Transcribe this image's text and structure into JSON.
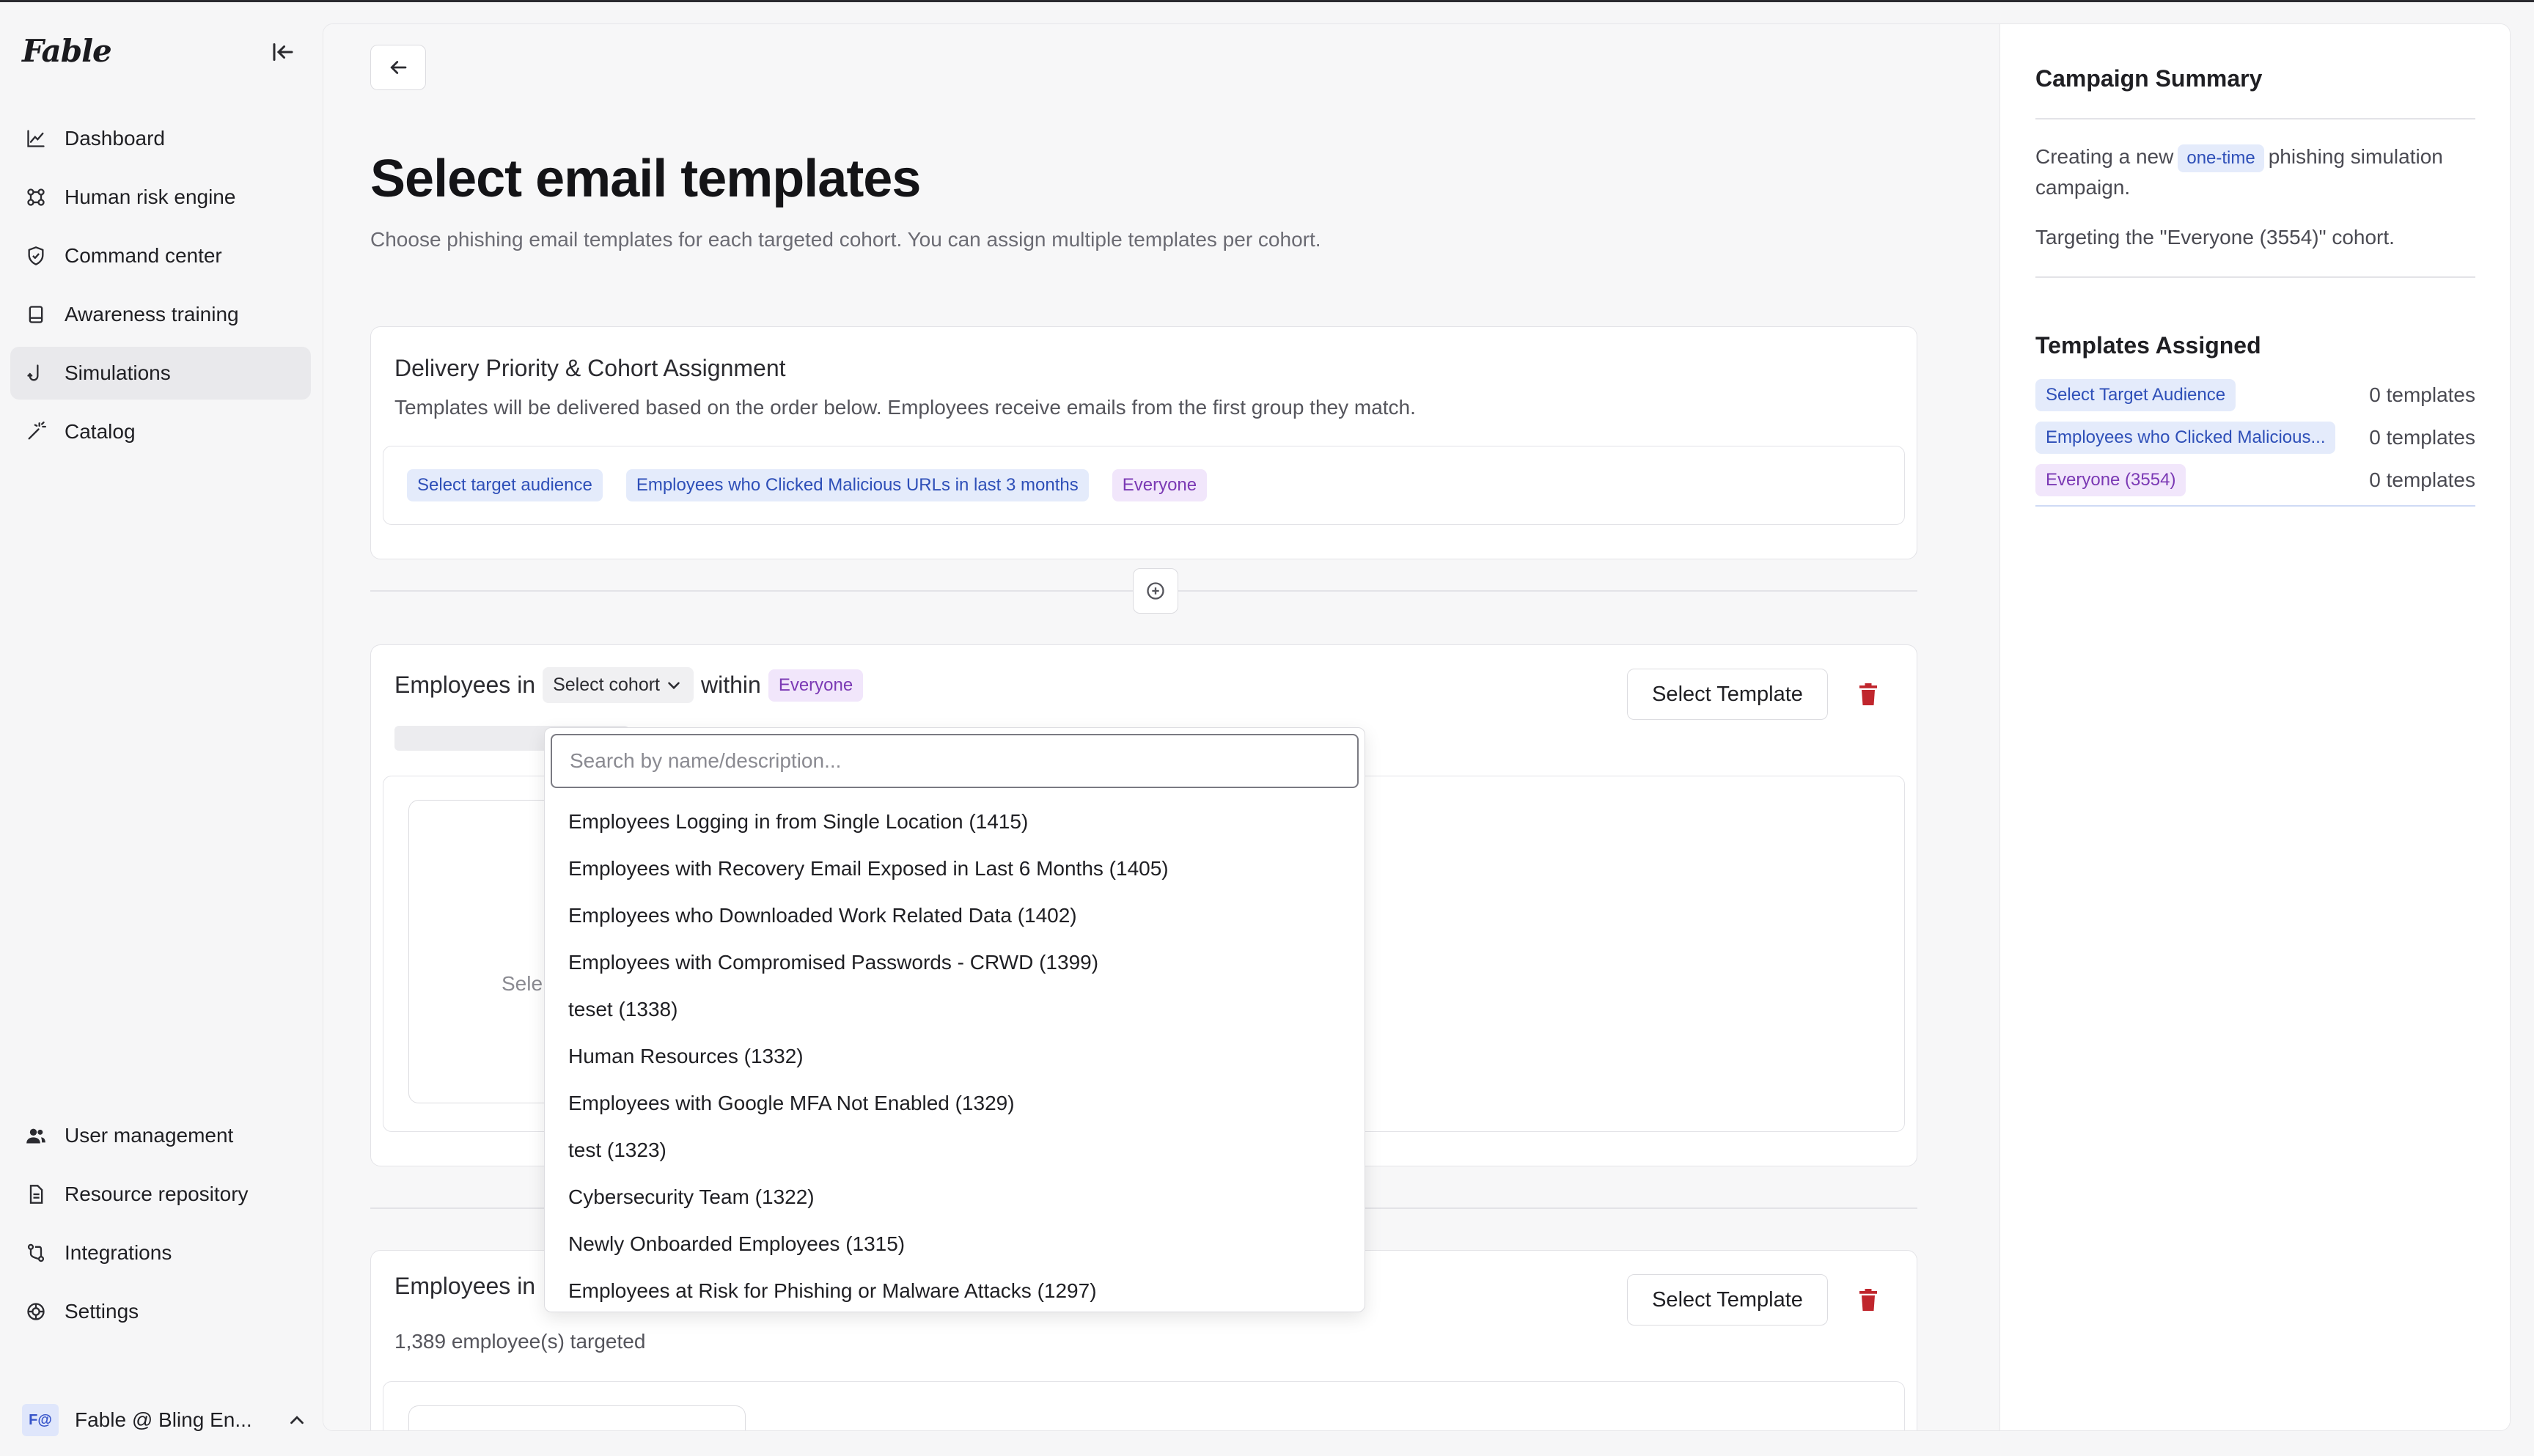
{
  "app": {
    "logo": "Fable",
    "nav_top": [
      {
        "label": "Dashboard",
        "icon": "chart-line-icon"
      },
      {
        "label": "Human risk engine",
        "icon": "network-icon"
      },
      {
        "label": "Command center",
        "icon": "shield-icon"
      },
      {
        "label": "Awareness training",
        "icon": "book-icon"
      },
      {
        "label": "Simulations",
        "icon": "hook-icon"
      },
      {
        "label": "Catalog",
        "icon": "wand-icon"
      }
    ],
    "nav_bottom": [
      {
        "label": "User management",
        "icon": "users-icon"
      },
      {
        "label": "Resource repository",
        "icon": "document-icon"
      },
      {
        "label": "Integrations",
        "icon": "git-merge-icon"
      },
      {
        "label": "Settings",
        "icon": "gear-icon"
      }
    ],
    "account": {
      "avatar": "F@",
      "name": "Fable @ Bling En..."
    }
  },
  "page": {
    "title": "Select email templates",
    "subtitle": "Choose phishing email templates for each targeted cohort. You can assign multiple templates per cohort."
  },
  "delivery": {
    "title": "Delivery Priority & Cohort Assignment",
    "description": "Templates will be delivered based on the order below. Employees receive emails from the first group they match.",
    "tags": [
      "Select target audience",
      "Employees who Clicked Malicious URLs in last 3 months",
      "Everyone"
    ]
  },
  "cohort1": {
    "prefix": "Employees in",
    "select_label": "Select cohort",
    "within": "within",
    "scope_tag": "Everyone",
    "select_template": "Select Template",
    "drop_label": "Sele"
  },
  "cohort2": {
    "prefix": "Employees in",
    "targeted": "1,389 employee(s) targeted",
    "select_template": "Select Template"
  },
  "dropdown": {
    "search_placeholder": "Search by name/description...",
    "items": [
      "Employees Logging in from Single Location (1415)",
      "Employees with Recovery Email Exposed in Last 6 Months (1405)",
      "Employees who Downloaded Work Related Data (1402)",
      "Employees with Compromised Passwords - CRWD (1399)",
      "teset (1338)",
      "Human Resources (1332)",
      "Employees with Google MFA Not Enabled (1329)",
      "test (1323)",
      "Cybersecurity Team (1322)",
      "Newly Onboarded Employees (1315)",
      "Employees at Risk for Phishing or Malware Attacks (1297)"
    ]
  },
  "summary": {
    "title": "Campaign Summary",
    "line1_a": "Creating a new",
    "line1_tag": "one-time",
    "line1_b": "phishing simulation campaign.",
    "line2": "Targeting the \"Everyone (3554)\" cohort.",
    "assigned_title": "Templates Assigned",
    "assigned": [
      {
        "tag": "Select Target Audience",
        "count": "0 templates"
      },
      {
        "tag": "Employees who Clicked Malicious...",
        "count": "0 templates"
      },
      {
        "tag": "Everyone (3554)",
        "count": "0 templates"
      }
    ]
  }
}
